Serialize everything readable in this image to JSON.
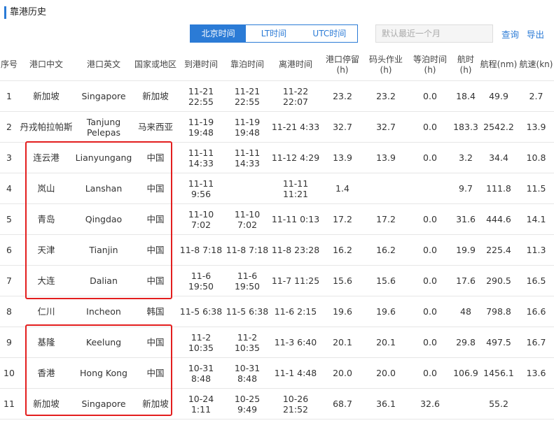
{
  "page": {
    "title": "靠港历史",
    "tabs": [
      "北京时间",
      "LT时间",
      "UTC时间"
    ],
    "date_placeholder": "默认最近一个月",
    "query_label": "查询",
    "export_label": "导出"
  },
  "table": {
    "headers": [
      "序号",
      "港口中文",
      "港口英文",
      "国家或地区",
      "到港时间",
      "靠泊时间",
      "离港时间",
      "港口停留(h)",
      "码头作业(h)",
      "等泊时间(h)",
      "航时(h)",
      "航程(nm)",
      "航速(kn)"
    ],
    "rows": [
      [
        "1",
        "新加坡",
        "Singapore",
        "新加坡",
        "11-21 22:55",
        "11-21 22:55",
        "11-22 22:07",
        "23.2",
        "23.2",
        "0.0",
        "18.4",
        "49.9",
        "2.7"
      ],
      [
        "2",
        "丹戎帕拉帕斯",
        "Tanjung Pelepas",
        "马来西亚",
        "11-19 19:48",
        "11-19 19:48",
        "11-21 4:33",
        "32.7",
        "32.7",
        "0.0",
        "183.3",
        "2542.2",
        "13.9"
      ],
      [
        "3",
        "连云港",
        "Lianyungang",
        "中国",
        "11-11 14:33",
        "11-11 14:33",
        "11-12 4:29",
        "13.9",
        "13.9",
        "0.0",
        "3.2",
        "34.4",
        "10.8"
      ],
      [
        "4",
        "岚山",
        "Lanshan",
        "中国",
        "11-11 9:56",
        "",
        "11-11 11:21",
        "1.4",
        "",
        "",
        "9.7",
        "111.8",
        "11.5"
      ],
      [
        "5",
        "青岛",
        "Qingdao",
        "中国",
        "11-10 7:02",
        "11-10 7:02",
        "11-11 0:13",
        "17.2",
        "17.2",
        "0.0",
        "31.6",
        "444.6",
        "14.1"
      ],
      [
        "6",
        "天津",
        "Tianjin",
        "中国",
        "11-8 7:18",
        "11-8 7:18",
        "11-8 23:28",
        "16.2",
        "16.2",
        "0.0",
        "19.9",
        "225.4",
        "11.3"
      ],
      [
        "7",
        "大连",
        "Dalian",
        "中国",
        "11-6 19:50",
        "11-6 19:50",
        "11-7 11:25",
        "15.6",
        "15.6",
        "0.0",
        "17.6",
        "290.5",
        "16.5"
      ],
      [
        "8",
        "仁川",
        "Incheon",
        "韩国",
        "11-5 6:38",
        "11-5 6:38",
        "11-6 2:15",
        "19.6",
        "19.6",
        "0.0",
        "48",
        "798.8",
        "16.6"
      ],
      [
        "9",
        "基隆",
        "Keelung",
        "中国",
        "11-2 10:35",
        "11-2 10:35",
        "11-3 6:40",
        "20.1",
        "20.1",
        "0.0",
        "29.8",
        "497.5",
        "16.7"
      ],
      [
        "10",
        "香港",
        "Hong Kong",
        "中国",
        "10-31 8:48",
        "10-31 8:48",
        "11-1 4:48",
        "20.0",
        "20.0",
        "0.0",
        "106.9",
        "1456.1",
        "13.6"
      ],
      [
        "11",
        "新加坡",
        "Singapore",
        "新加坡",
        "10-24 1:11",
        "10-25 9:49",
        "10-26 21:52",
        "68.7",
        "36.1",
        "32.6",
        "",
        "55.2",
        ""
      ]
    ]
  },
  "colors": {
    "accent": "#2b7bd6",
    "highlight": "#e31e1e"
  }
}
